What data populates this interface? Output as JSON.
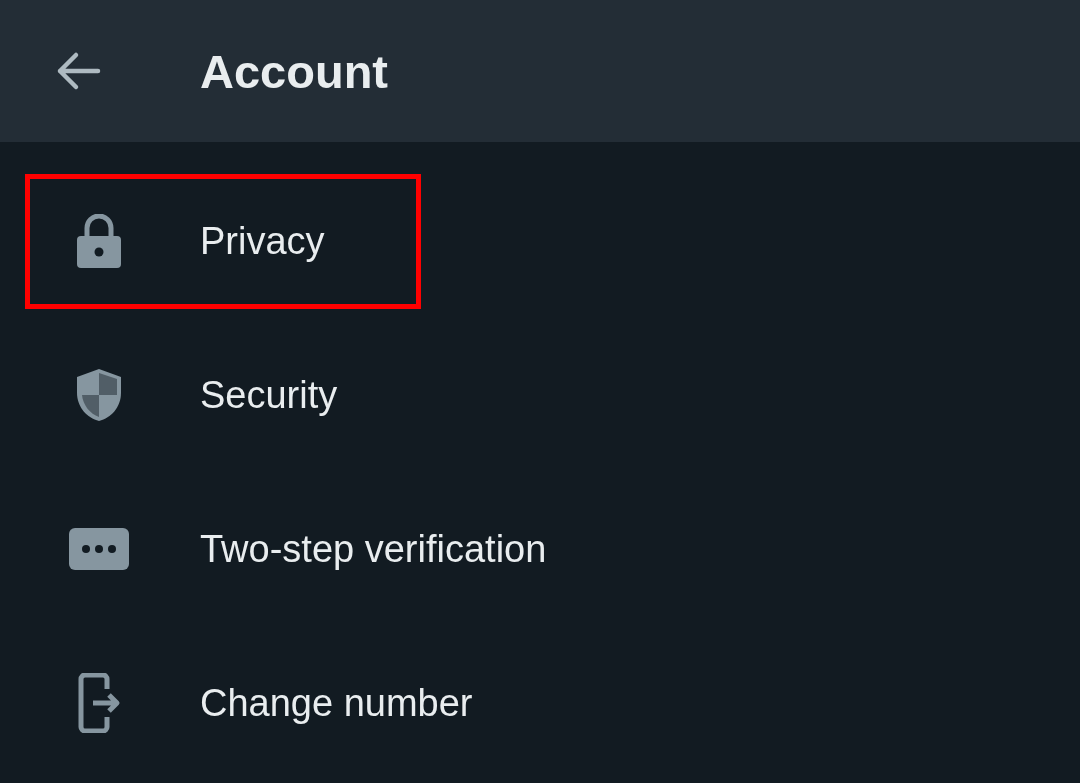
{
  "header": {
    "title": "Account"
  },
  "items": [
    {
      "kind": "lock",
      "label": "Privacy",
      "highlighted": true
    },
    {
      "kind": "shield",
      "label": "Security",
      "highlighted": false
    },
    {
      "kind": "dots",
      "label": "Two-step verification",
      "highlighted": false
    },
    {
      "kind": "exit",
      "label": "Change number",
      "highlighted": false
    }
  ]
}
